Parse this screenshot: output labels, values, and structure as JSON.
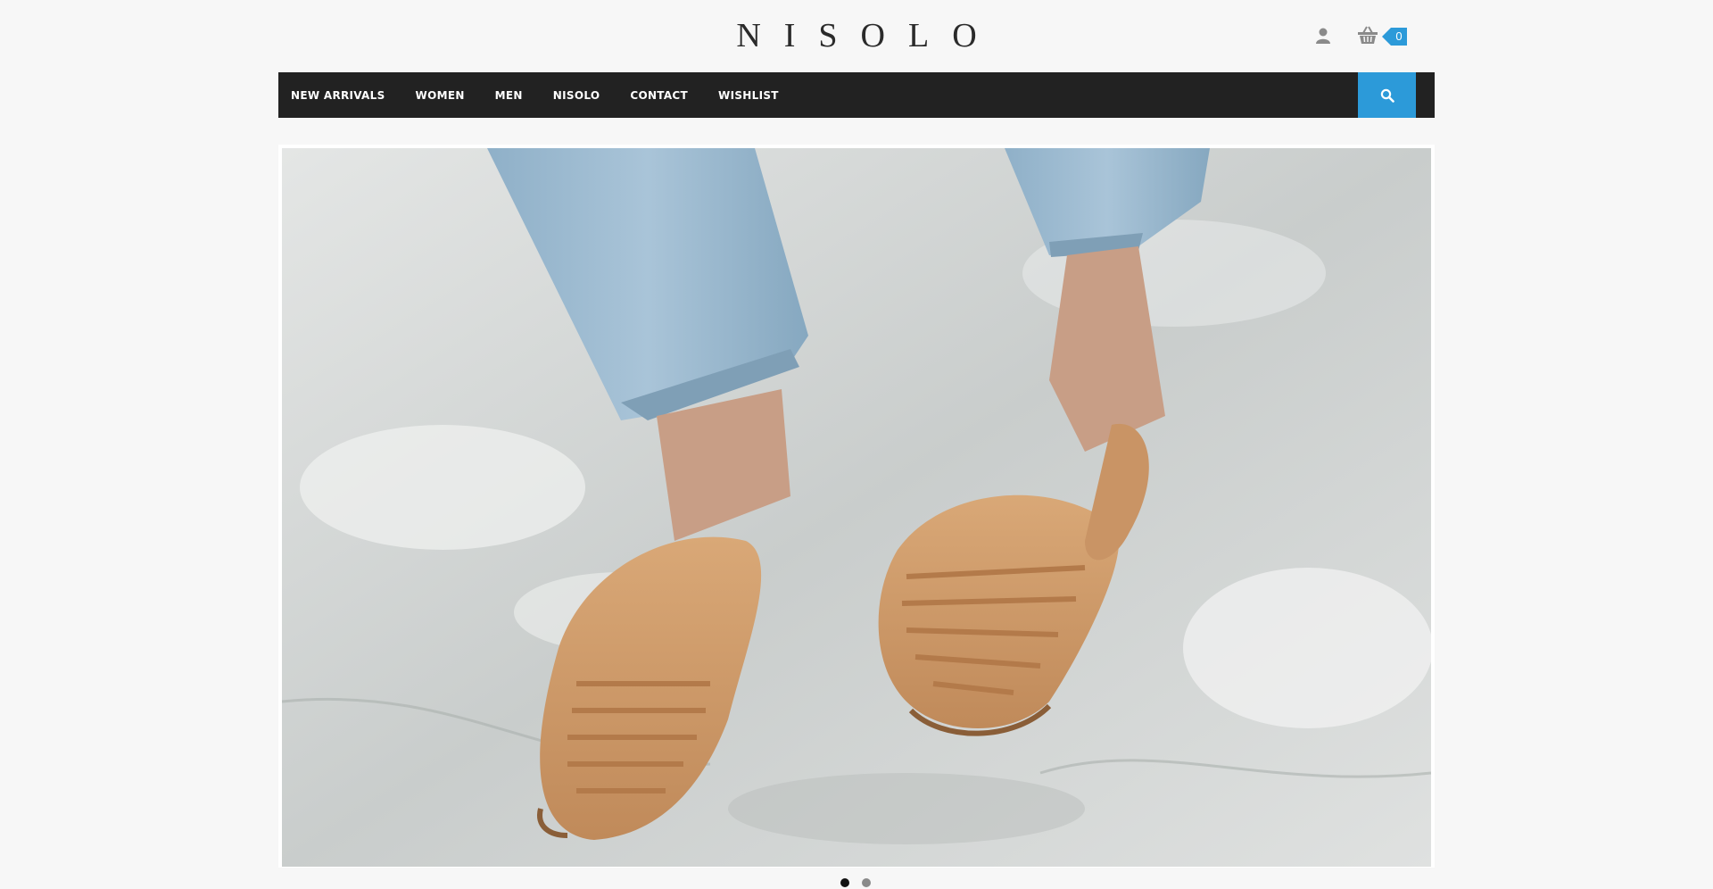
{
  "header": {
    "logo": "NISOLO",
    "cart_count": "0"
  },
  "nav": {
    "items": [
      {
        "label": "NEW ARRIVALS"
      },
      {
        "label": "WOMEN"
      },
      {
        "label": "MEN"
      },
      {
        "label": "NISOLO"
      },
      {
        "label": "CONTACT"
      },
      {
        "label": "WISHLIST"
      }
    ]
  },
  "icons": {
    "account": "user-icon",
    "cart": "basket-icon",
    "search": "search-icon"
  },
  "colors": {
    "accent": "#2c9ad9",
    "navbar": "#222222",
    "page_background": "#f7f7f7"
  },
  "hero": {
    "slides": 2,
    "active_slide": 1
  }
}
